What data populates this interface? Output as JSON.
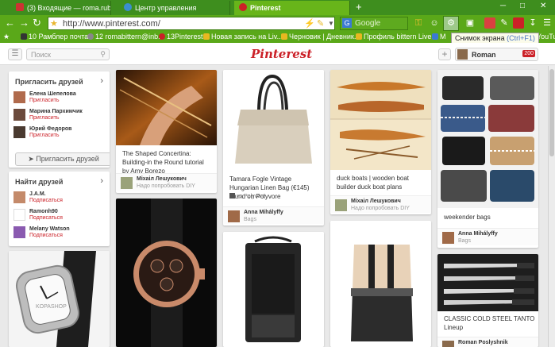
{
  "browser": {
    "tabs": [
      {
        "label": "(3) Входящие — roma.rubzoff@...",
        "active": false,
        "icon_color": "#c33"
      },
      {
        "label": "Центр управления",
        "active": false,
        "icon_color": "#3b8ed0"
      },
      {
        "label": "Pinterest",
        "active": true,
        "icon_color": "#cb2027"
      }
    ],
    "new_tab": "+",
    "url": "http://www.pinterest.com/",
    "search_placeholder": "Google",
    "search_engine_letter": "G",
    "bookmarks": [
      "10 Рамблер почта",
      "12 romabittern@inb...",
      "13Pinterest",
      "Новая запись на Liv...",
      "Черновик | Дневник...",
      "Профиль bittern Live...",
      "M",
      "YouTu"
    ],
    "tooltip": {
      "label": "Снимок экрана",
      "shortcut": "(Ctrl+F1)"
    }
  },
  "header": {
    "search_placeholder": "Поиск",
    "logo": "Pinterest",
    "user_name": "Roman",
    "notification_count": "200"
  },
  "sidebar": {
    "invite": {
      "title": "Пригласить друзей",
      "friends": [
        {
          "name": "Елена Шепелова",
          "action": "Пригласить"
        },
        {
          "name": "Марина Пархимчик",
          "action": "Пригласить"
        },
        {
          "name": "Юрий Федоров",
          "action": "Пригласить"
        }
      ],
      "button_label": "Пригласить друзей"
    },
    "find": {
      "title": "Найти друзей",
      "friends": [
        {
          "name": "J.A.M.",
          "action": "Подписаться"
        },
        {
          "name": "Ramonh90",
          "action": "Подписаться"
        },
        {
          "name": "Melany Watson",
          "action": "Подписаться"
        }
      ]
    },
    "watch_thumb_text": "KOPASHOP"
  },
  "pins": {
    "concertina": {
      "description": "The Shaped Concertina: Building-in the Round tutorial by Amy Borezo",
      "user": "Міхаіл Лешукович",
      "board": "Надо попробовать DIY"
    },
    "bag": {
      "description": "Tamara Fogle Vintage Hungarian Linen Bag (€145) found on Polyvore",
      "source": "из Polyvore",
      "user": "Anna Mihályffy",
      "board": "Bags"
    },
    "boats": {
      "description": "duck boats | wooden boat builder duck boat plans",
      "user": "Міхаіл Лешукович",
      "board": "Надо попробовать DIY"
    },
    "weekender": {
      "description": "weekender bags",
      "user": "Anna Mihályffy",
      "board": "Bags"
    },
    "knives": {
      "description": "CLASSIC COLD STEEL TANTO Lineup",
      "user": "Roman Poslyshnik"
    }
  }
}
